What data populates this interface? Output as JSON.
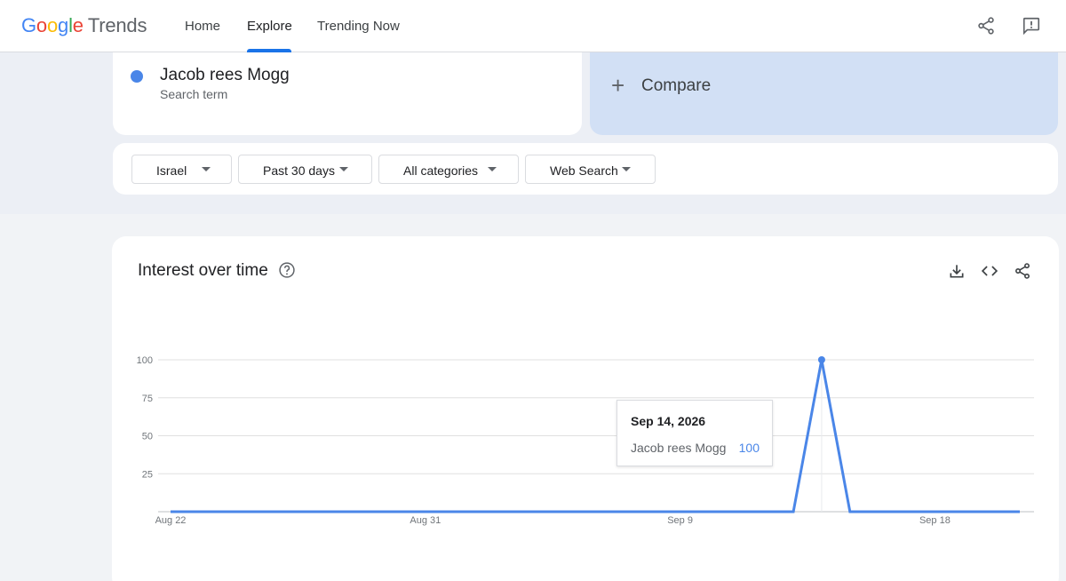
{
  "header": {
    "logo_letters": [
      "G",
      "o",
      "o",
      "g",
      "l",
      "e"
    ],
    "logo_product": "Trends",
    "nav": {
      "home": "Home",
      "explore": "Explore",
      "trending": "Trending Now"
    },
    "icons": [
      "share-icon",
      "feedback-icon"
    ]
  },
  "search_term": {
    "name": "Jacob rees Mogg",
    "type": "Search term",
    "color": "#4a86e8"
  },
  "compare": {
    "label": "Compare"
  },
  "filters": {
    "region": "Israel",
    "time_range": "Past 30 days",
    "category": "All categories",
    "search_type": "Web Search"
  },
  "chart_card": {
    "title": "Interest over time",
    "icons": [
      "help-icon",
      "download-icon",
      "embed-icon",
      "share-icon"
    ]
  },
  "tooltip": {
    "date": "Sep 14, 2026",
    "term": "Jacob rees Mogg",
    "value": "100"
  },
  "chart_data": {
    "type": "line",
    "xlabel": "",
    "ylabel": "",
    "ylim": [
      0,
      100
    ],
    "y_ticks": [
      "100",
      "75",
      "50",
      "25"
    ],
    "x_ticks": [
      "Aug 22",
      "Aug 31",
      "Sep 9",
      "Sep 18"
    ],
    "grid": true,
    "series": [
      {
        "name": "Jacob rees Mogg",
        "color": "#4a86e8",
        "x": [
          "Aug 22",
          "Aug 23",
          "Aug 24",
          "Aug 25",
          "Aug 26",
          "Aug 27",
          "Aug 28",
          "Aug 29",
          "Aug 30",
          "Aug 31",
          "Sep 1",
          "Sep 2",
          "Sep 3",
          "Sep 4",
          "Sep 5",
          "Sep 6",
          "Sep 7",
          "Sep 8",
          "Sep 9",
          "Sep 10",
          "Sep 11",
          "Sep 12",
          "Sep 13",
          "Sep 14",
          "Sep 15",
          "Sep 16",
          "Sep 17",
          "Sep 18",
          "Sep 19",
          "Sep 20",
          "Sep 21"
        ],
        "values": [
          0,
          0,
          0,
          0,
          0,
          0,
          0,
          0,
          0,
          0,
          0,
          0,
          0,
          0,
          0,
          0,
          0,
          0,
          0,
          0,
          0,
          0,
          0,
          100,
          0,
          0,
          0,
          0,
          0,
          0,
          0
        ]
      }
    ]
  }
}
